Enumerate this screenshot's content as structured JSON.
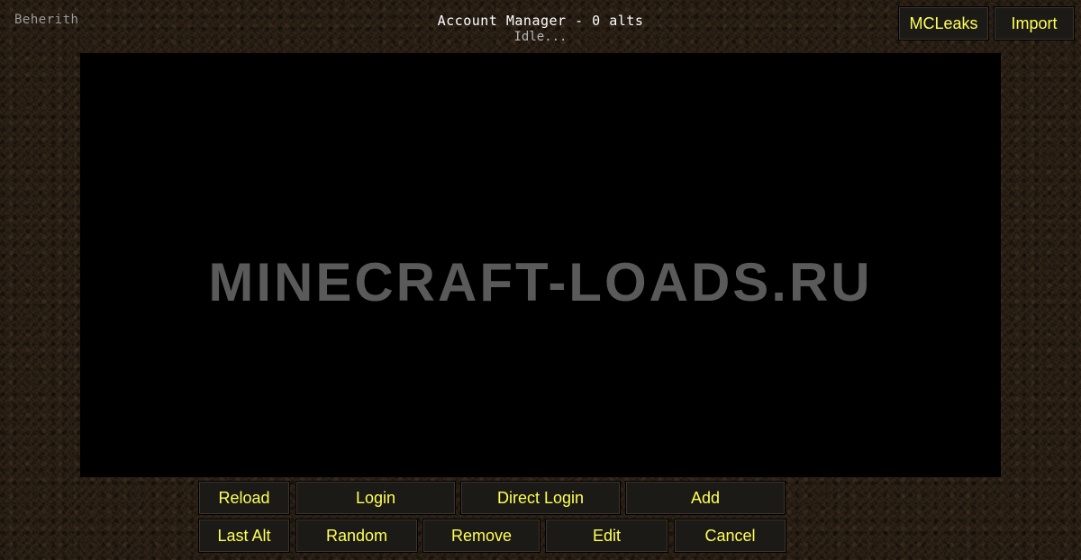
{
  "header": {
    "username": "Beherith",
    "title": "Account Manager - 0 alts",
    "status": "Idle..."
  },
  "top_buttons": {
    "mcleaks": "MCLeaks",
    "import": "Import"
  },
  "main": {
    "watermark": "MINECRAFT-LOADS.RU"
  },
  "bottom_buttons": {
    "reload": "Reload",
    "login": "Login",
    "direct_login": "Direct Login",
    "add": "Add",
    "last_alt": "Last Alt",
    "random": "Random",
    "remove": "Remove",
    "edit": "Edit",
    "cancel": "Cancel"
  },
  "colors": {
    "button_text": "#ffff55",
    "title_text": "#ffffff",
    "panel_bg": "#000000"
  }
}
